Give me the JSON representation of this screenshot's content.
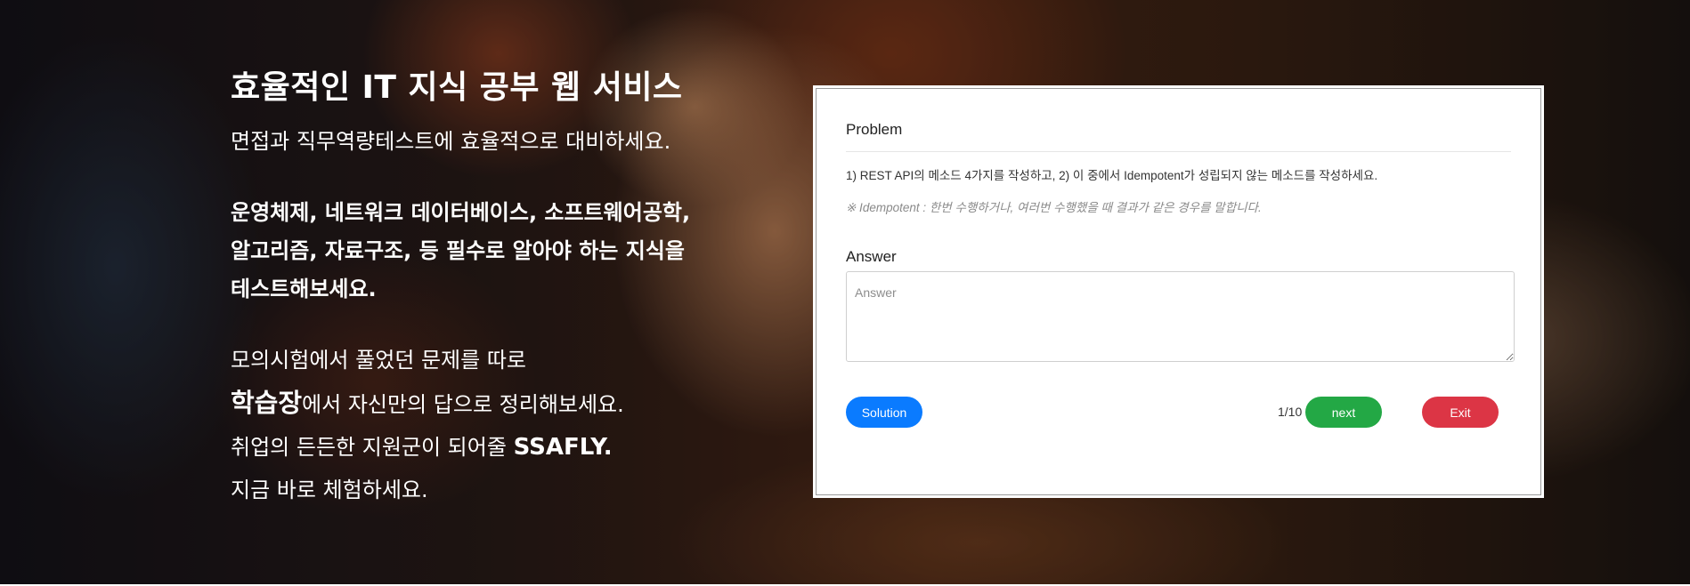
{
  "hero": {
    "title": "효율적인 IT 지식 공부 웹 서비스",
    "subtitle": "면접과 직무역량테스트에 효율적으로 대비하세요.",
    "subjects_lines": [
      "운영체제, 네트워크 데이터베이스, 소프트웨어공학,",
      "알고리즘, 자료구조, 등 필수로 알아야 하는 지식을",
      "테스트해보세요."
    ],
    "closing": {
      "line1": "모의시험에서 풀었던 문제를 따로",
      "line2_bold": "학습장",
      "line2_rest": "에서 자신만의 답으로 정리해보세요.",
      "line3_prefix": "취업의 든든한 지원군이 되어줄 ",
      "line3_brand": "SSAFLY.",
      "line4": "지금 바로 체험하세요."
    }
  },
  "quiz": {
    "problem_label": "Problem",
    "question": "1) REST API의 메소드 4가지를 작성하고, 2) 이 중에서 Idempotent가 성립되지 않는 메소드를 작성하세요.",
    "note": "※ Idempotent : 한번 수행하거나, 여러번 수행했을 때 결과가 같은 경우를 말합니다.",
    "answer_label": "Answer",
    "answer_placeholder": "Answer",
    "answer_value": "",
    "solution_button": "Solution",
    "progress": "1/10",
    "next_button": "next",
    "exit_button": "Exit"
  },
  "colors": {
    "solution": "#0a7bff",
    "next": "#23a845",
    "exit": "#dc3545"
  }
}
